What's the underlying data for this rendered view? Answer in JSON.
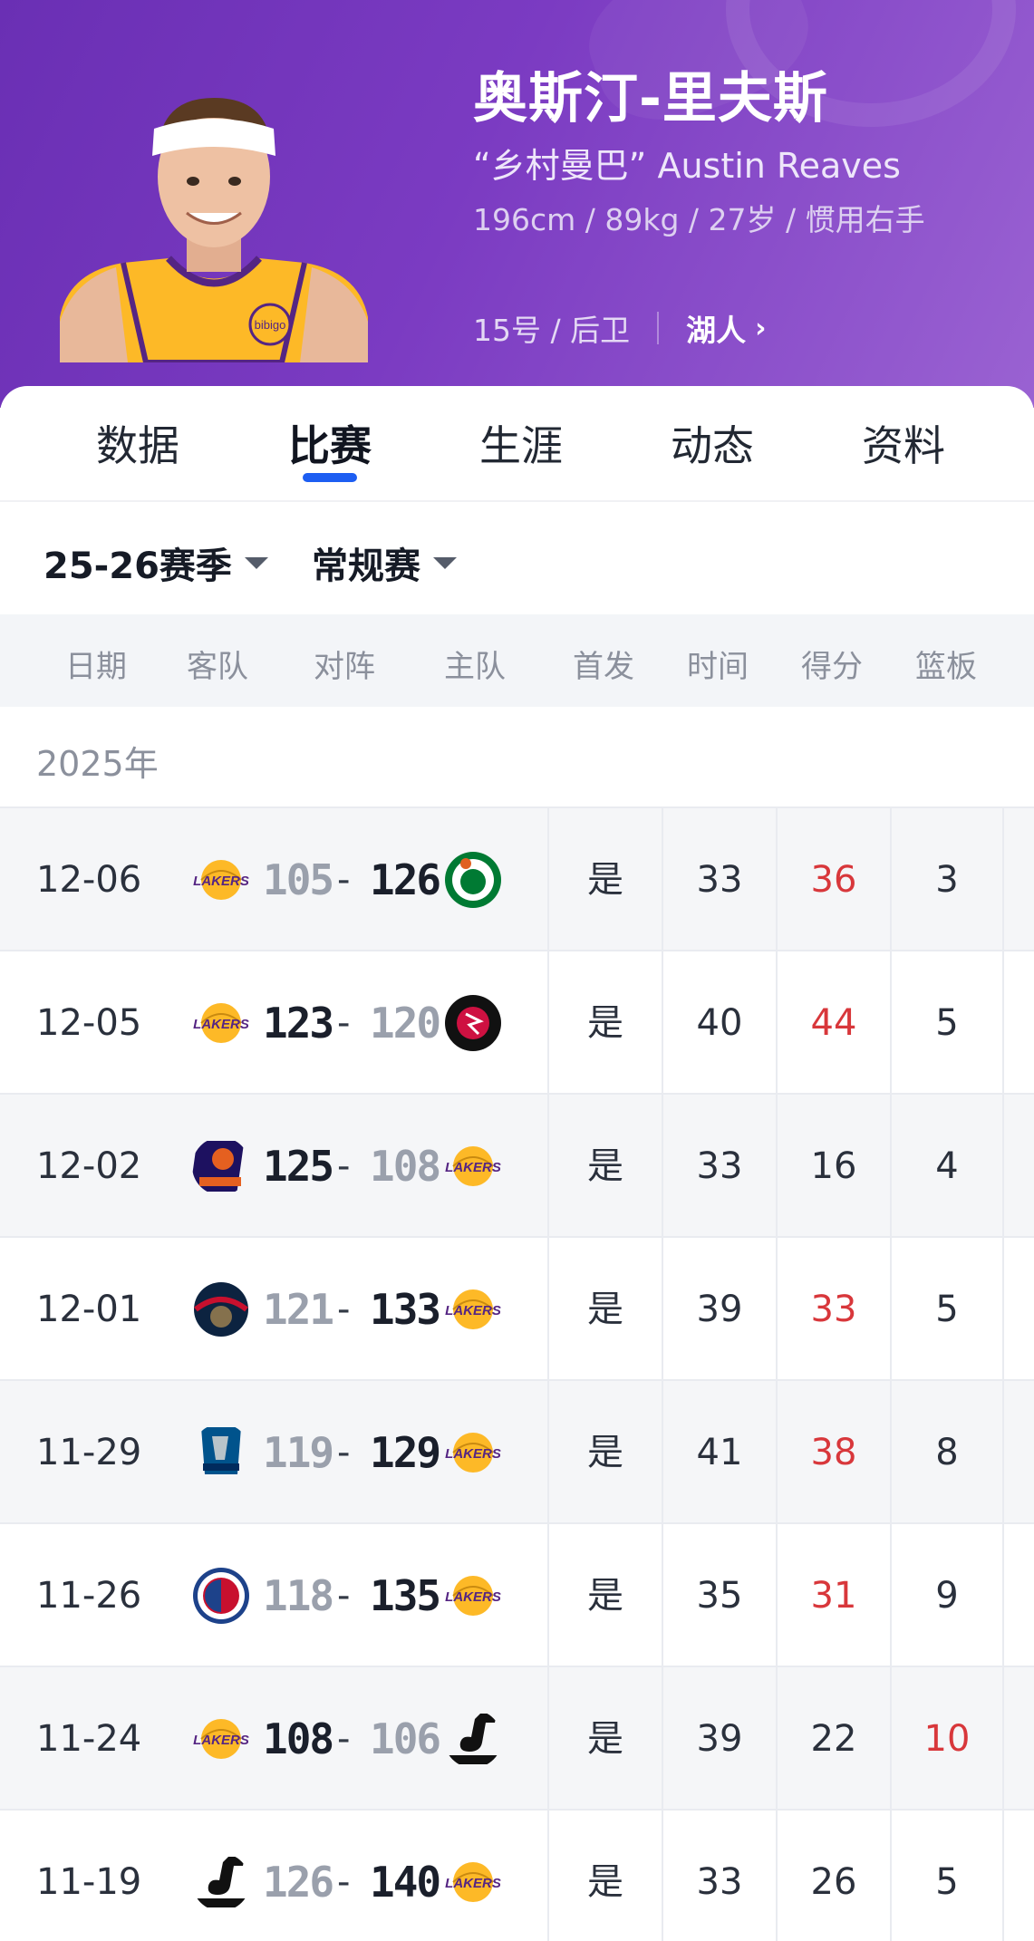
{
  "player": {
    "name": "奥斯汀-里夫斯",
    "nickname": "“乡村曼巴” Austin Reaves",
    "body_info": "196cm / 89kg / 27岁 / 惯用右手",
    "number_position": "15号 / 后卫",
    "team": "湖人",
    "team_color": "#552583",
    "jersey_color": "#fdb927"
  },
  "tabs": [
    {
      "label": "数据",
      "active": false
    },
    {
      "label": "比赛",
      "active": true
    },
    {
      "label": "生涯",
      "active": false
    },
    {
      "label": "动态",
      "active": false
    },
    {
      "label": "资料",
      "active": false
    }
  ],
  "filters": {
    "season": "25-26赛季",
    "type": "常规赛"
  },
  "columns": [
    "日期",
    "客队",
    "对阵",
    "主队",
    "首发",
    "时间",
    "得分",
    "篮板"
  ],
  "year_label": "2025年",
  "accent": {
    "tab_underline": "#1d5ef2",
    "highlight": "#d8373b"
  },
  "games": [
    {
      "date": "12-06",
      "away_logo": "lakers-logo",
      "home_logo": "celtics-logo",
      "away_score": "105",
      "home_score": "126",
      "winner": "home",
      "starter": "是",
      "minutes": "33",
      "points": "36",
      "points_hl": true,
      "rebounds": "3",
      "reb_hl": false
    },
    {
      "date": "12-05",
      "away_logo": "lakers-logo",
      "home_logo": "raptors-logo",
      "away_score": "123",
      "home_score": "120",
      "winner": "away",
      "starter": "是",
      "minutes": "40",
      "points": "44",
      "points_hl": true,
      "rebounds": "5",
      "reb_hl": false
    },
    {
      "date": "12-02",
      "away_logo": "suns-logo",
      "home_logo": "lakers-logo",
      "away_score": "125",
      "home_score": "108",
      "winner": "away",
      "starter": "是",
      "minutes": "33",
      "points": "16",
      "points_hl": false,
      "rebounds": "4",
      "reb_hl": false
    },
    {
      "date": "12-01",
      "away_logo": "pelicans-logo",
      "home_logo": "lakers-logo",
      "away_score": "121",
      "home_score": "133",
      "winner": "home",
      "starter": "是",
      "minutes": "39",
      "points": "33",
      "points_hl": true,
      "rebounds": "5",
      "reb_hl": false
    },
    {
      "date": "11-29",
      "away_logo": "mavericks-logo",
      "home_logo": "lakers-logo",
      "away_score": "119",
      "home_score": "129",
      "winner": "home",
      "starter": "是",
      "minutes": "41",
      "points": "38",
      "points_hl": true,
      "rebounds": "8",
      "reb_hl": false
    },
    {
      "date": "11-26",
      "away_logo": "clippers-logo",
      "home_logo": "lakers-logo",
      "away_score": "118",
      "home_score": "135",
      "winner": "home",
      "starter": "是",
      "minutes": "35",
      "points": "31",
      "points_hl": true,
      "rebounds": "9",
      "reb_hl": false
    },
    {
      "date": "11-24",
      "away_logo": "lakers-logo",
      "home_logo": "jazz-logo",
      "away_score": "108",
      "home_score": "106",
      "winner": "away",
      "starter": "是",
      "minutes": "39",
      "points": "22",
      "points_hl": false,
      "rebounds": "10",
      "reb_hl": true
    },
    {
      "date": "11-19",
      "away_logo": "jazz-logo",
      "home_logo": "lakers-logo",
      "away_score": "126",
      "home_score": "140",
      "winner": "home",
      "starter": "是",
      "minutes": "33",
      "points": "26",
      "points_hl": false,
      "rebounds": "5",
      "reb_hl": false
    }
  ]
}
